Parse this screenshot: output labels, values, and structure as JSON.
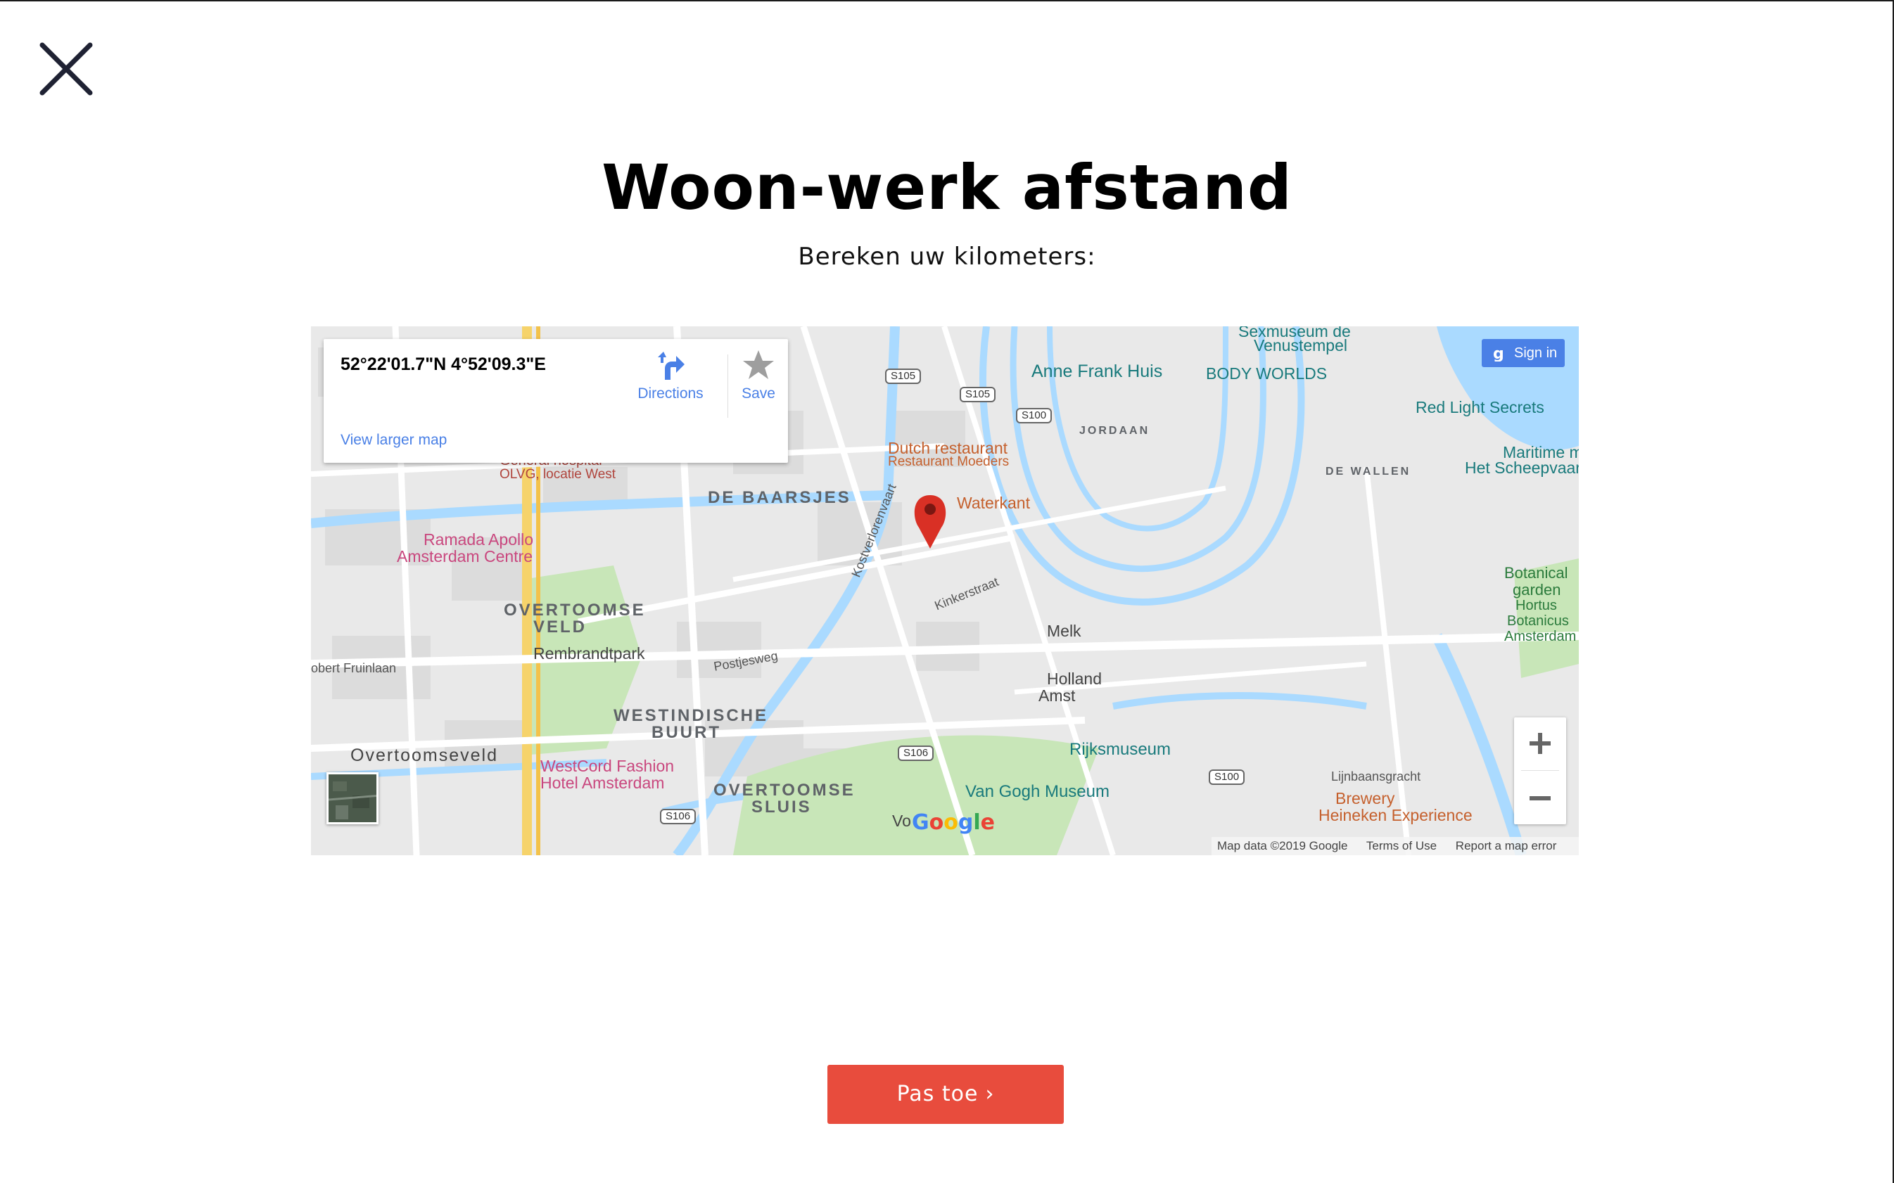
{
  "header": {
    "title": "Woon-werk afstand",
    "subtitle": "Bereken uw kilometers:"
  },
  "map": {
    "info_card": {
      "coordinates": "52°22'01.7\"N 4°52'09.3\"E",
      "directions_label": "Directions",
      "save_label": "Save",
      "view_larger_label": "View larger map"
    },
    "sign_in_label": "Sign in",
    "attribution": {
      "map_data": "Map data ©2019 Google",
      "terms": "Terms of Use",
      "report": "Report a map error"
    },
    "logo_text": "Google",
    "district_labels": {
      "de_baarsjes": "DE BAARSJES",
      "overtoomse_veld_1": "OVERTOOMSE",
      "overtoomse_veld_2": "VELD",
      "westindische_1": "WESTINDISCHE",
      "westindische_2": "BUURT",
      "overtoomse_sluis_1": "OVERTOOMSE",
      "overtoomse_sluis_2": "SLUIS",
      "jordaan": "JORDAAN",
      "de_wallen": "DE WALLEN"
    },
    "place_labels": {
      "anne_frank": "Anne Frank Huis",
      "body_worlds": "BODY WORLDS",
      "sexmuseum_1": "Sexmuseum de",
      "sexmuseum_2": "Venustempel",
      "red_light": "Red Light Secrets",
      "maritime_1": "Maritime mu",
      "maritime_2": "Het Scheepvaartm",
      "dutch_restaurant_1": "Dutch restaurant",
      "dutch_restaurant_2": "Restaurant Moeders",
      "waterkant": "Waterkant",
      "general_hospital_1": "General hospital",
      "general_hospital_2": "OLVG, locatie West",
      "ramada_1": "Ramada Apollo",
      "ramada_2": "Amsterdam Centre",
      "rembrandtpark": "Rembrandtpark",
      "overtoomseveld": "Overtoomseveld",
      "westcord_1": "WestCord Fashion",
      "westcord_2": "Hotel Amsterdam",
      "rijksmuseum": "Rijksmuseum",
      "van_gogh": "Van Gogh Museum",
      "brewery_1": "Brewery",
      "brewery_2": "Heineken Experience",
      "botanical_1": "Botanical",
      "botanical_2": "garden",
      "botanical_3": "Hortus",
      "botanical_4": "Botanicus",
      "botanical_5": "Amsterdam",
      "holland_1": "Holland",
      "holland_2": "Amst",
      "melk": "Melk",
      "lijnbaansgracht": "Lijnbaansgracht",
      "kinkerstraat": "Kinkerstraat",
      "postjesweg": "Postjesweg",
      "kostverlorenvaart": "Kostverlorenvaart",
      "robert_fruinlaan": "obert Fruinlaan",
      "vo": "Vo"
    },
    "road_shields": [
      "S105",
      "S105",
      "S100",
      "S106",
      "S106",
      "S100"
    ]
  },
  "action": {
    "apply_label": "Pas toe"
  },
  "colors": {
    "accent": "#e84c3d",
    "map_link": "#4a80e6",
    "water": "#aadaff",
    "park": "#c8e6b8",
    "marker": "#d93025"
  }
}
